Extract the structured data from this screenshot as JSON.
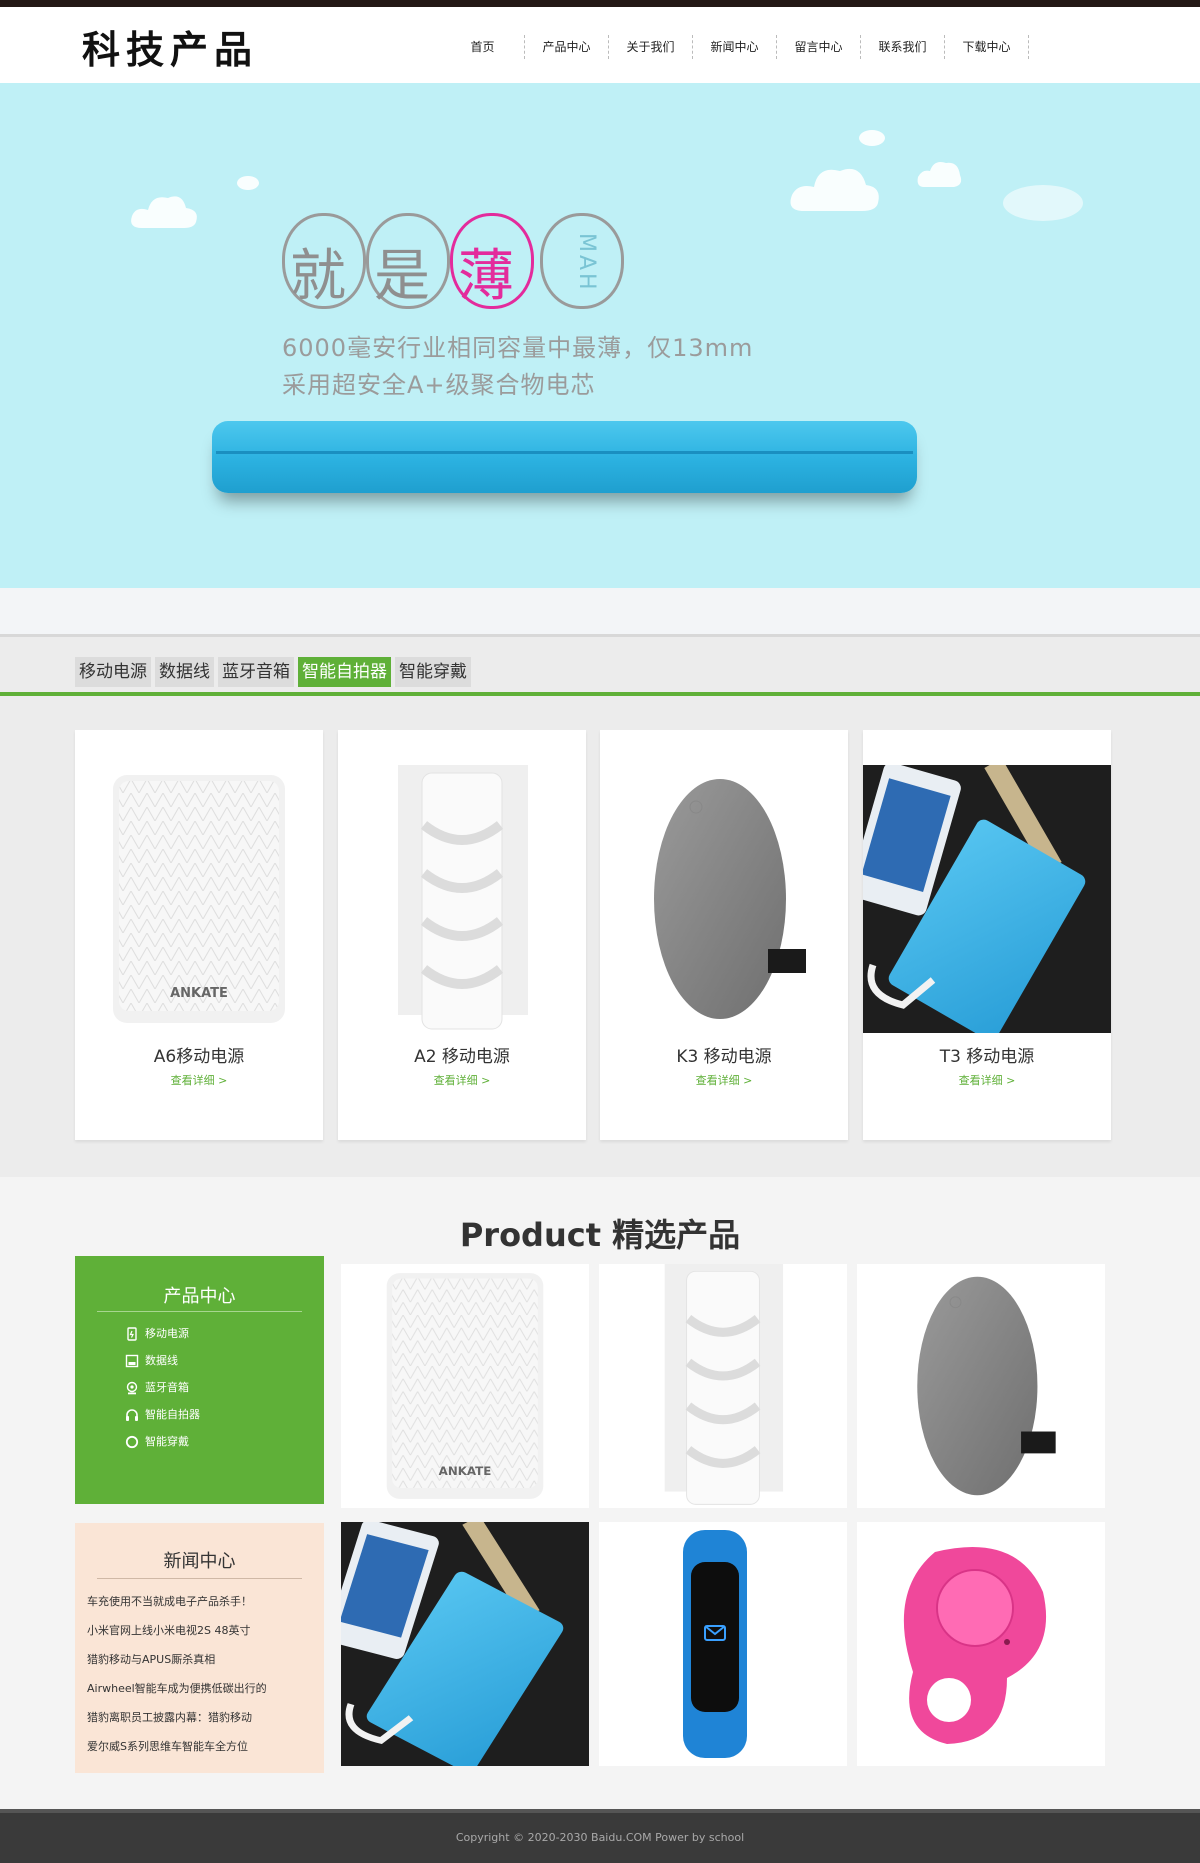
{
  "site": {
    "logo": "科技产品"
  },
  "nav": [
    "首页",
    "产品中心",
    "关于我们",
    "新闻中心",
    "留言中心",
    "联系我们",
    "下载中心"
  ],
  "banner": {
    "headline_chars": [
      "就",
      "是",
      "薄"
    ],
    "unit": "MAH",
    "line1": "6000毫安行业相同容量中最薄，仅13mm",
    "line2": "采用超安全A+级聚合物电芯"
  },
  "tabs": [
    {
      "label": "移动电源",
      "active": false
    },
    {
      "label": "数据线",
      "active": false
    },
    {
      "label": "蓝牙音箱",
      "active": false
    },
    {
      "label": "智能自拍器",
      "active": true
    },
    {
      "label": "智能穿戴",
      "active": false
    }
  ],
  "cards": [
    {
      "name": "A6移动电源",
      "more": "查看详细 >",
      "image": "white-powerbank-ankate"
    },
    {
      "name": "A2 移动电源",
      "more": "查看详细 >",
      "image": "white-cylinder-powerbank"
    },
    {
      "name": "K3 移动电源",
      "more": "查看详细 >",
      "image": "gray-pebble-powerbank"
    },
    {
      "name": "T3 移动电源",
      "more": "查看详细 >",
      "image": "blue-powerbank-with-phone"
    }
  ],
  "featured": {
    "title": "Product 精选产品",
    "products": [
      "white-powerbank-ankate",
      "white-cylinder-powerbank",
      "gray-pebble-powerbank",
      "blue-powerbank-with-phone",
      "blue-smart-band",
      "pink-selfie-remote"
    ]
  },
  "product_center": {
    "title": "产品中心",
    "items": [
      {
        "label": "移动电源",
        "icon": "battery-icon"
      },
      {
        "label": "数据线",
        "icon": "cable-icon"
      },
      {
        "label": "蓝牙音箱",
        "icon": "speaker-icon"
      },
      {
        "label": "智能自拍器",
        "icon": "headphones-icon"
      },
      {
        "label": "智能穿戴",
        "icon": "ring-icon"
      }
    ]
  },
  "news_center": {
    "title": "新闻中心",
    "items": [
      "车充使用不当就成电子产品杀手！",
      "小米官网上线小米电视2S 48英寸",
      "猎豹移动与APUS厮杀真相",
      "Airwheel智能车成为便携低碳出行的",
      "猎豹离职员工披露内幕：猎豹移动",
      "爱尔威S系列思维车智能车全方位"
    ]
  },
  "colors": {
    "accent_green": "#5fb038",
    "banner_bg": "#bff0f6",
    "news_bg": "#fae5d6",
    "header_strip": "#231815"
  },
  "footer": {
    "copyright": "Copyright © 2020-2030 Baidu.COM Power by school"
  }
}
